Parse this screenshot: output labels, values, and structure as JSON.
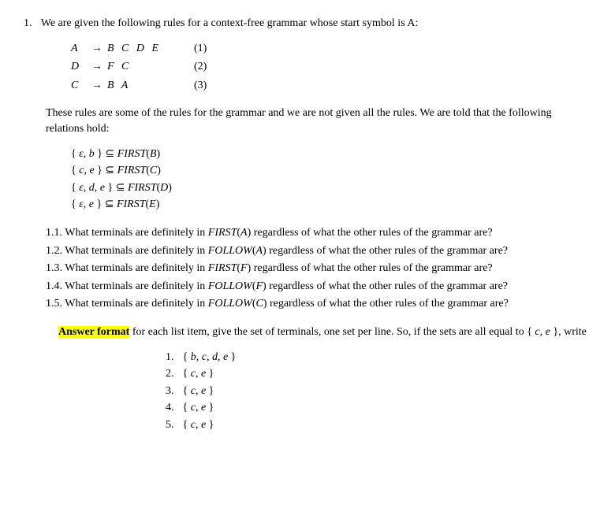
{
  "q_number": "1.",
  "q_intro": "We are given the following rules for a context-free grammar whose start symbol is A:",
  "rules": [
    {
      "lhs": "A",
      "arrow": "→",
      "rhs": "B C D E",
      "num": "(1)"
    },
    {
      "lhs": "D",
      "arrow": "→",
      "rhs": "F C",
      "num": "(2)"
    },
    {
      "lhs": "C",
      "arrow": "→",
      "rhs": "B A",
      "num": "(3)"
    }
  ],
  "para1": "These rules are some of the rules for the grammar and we are not given all the rules. We are told that the following relations hold:",
  "relations": [
    "{ ε, b } ⊆ FIRST(B)",
    "{ c, e } ⊆ FIRST(C)",
    "{ ε, d, e } ⊆ FIRST(D)",
    "{ ε, e } ⊆ FIRST(E)"
  ],
  "subquestions": [
    {
      "num": "1.1.",
      "text": "What terminals are definitely in FIRST(A) regardless of what the other rules of the grammar are?"
    },
    {
      "num": "1.2.",
      "text": "What terminals are definitely in FOLLOW(A) regardless of what the other rules of the grammar are?"
    },
    {
      "num": "1.3.",
      "text": "What terminals are definitely in FIRST(F) regardless of what the other rules of the grammar are?"
    },
    {
      "num": "1.4.",
      "text": "What terminals are definitely in FOLLOW(F) regardless of what the other rules of the grammar are?"
    },
    {
      "num": "1.5.",
      "text": "What terminals are definitely in FOLLOW(C) regardless of what the other rules of the grammar are?"
    }
  ],
  "answer_format_label": "Answer format",
  "answer_format_text1": " for each list item, give the set of terminals, one set per line. So, if the sets are all equal to { ",
  "answer_format_text2": "c, e",
  "answer_format_text3": " }, write",
  "examples": [
    {
      "num": "1.",
      "set": "{ b, c, d, e }"
    },
    {
      "num": "2.",
      "set": "{ c, e }"
    },
    {
      "num": "3.",
      "set": "{ c, e }"
    },
    {
      "num": "4.",
      "set": "{ c, e }"
    },
    {
      "num": "5.",
      "set": "{ c, e }"
    }
  ]
}
